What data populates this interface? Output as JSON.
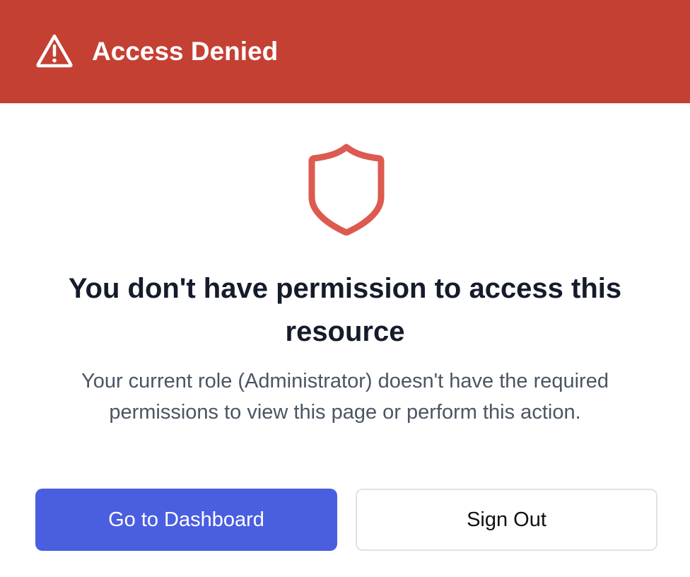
{
  "header": {
    "icon": "warning-triangle-icon",
    "title": "Access Denied",
    "background_color": "#c44033"
  },
  "main": {
    "icon": "shield-icon",
    "icon_color": "#dc5a4f",
    "heading": "You don't have permission to access this resource",
    "message": "Your current role (Administrator) doesn't have the required permissions to view this page or perform this action."
  },
  "actions": {
    "primary_label": "Go to Dashboard",
    "primary_color": "#4a5ee0",
    "secondary_label": "Sign Out"
  }
}
